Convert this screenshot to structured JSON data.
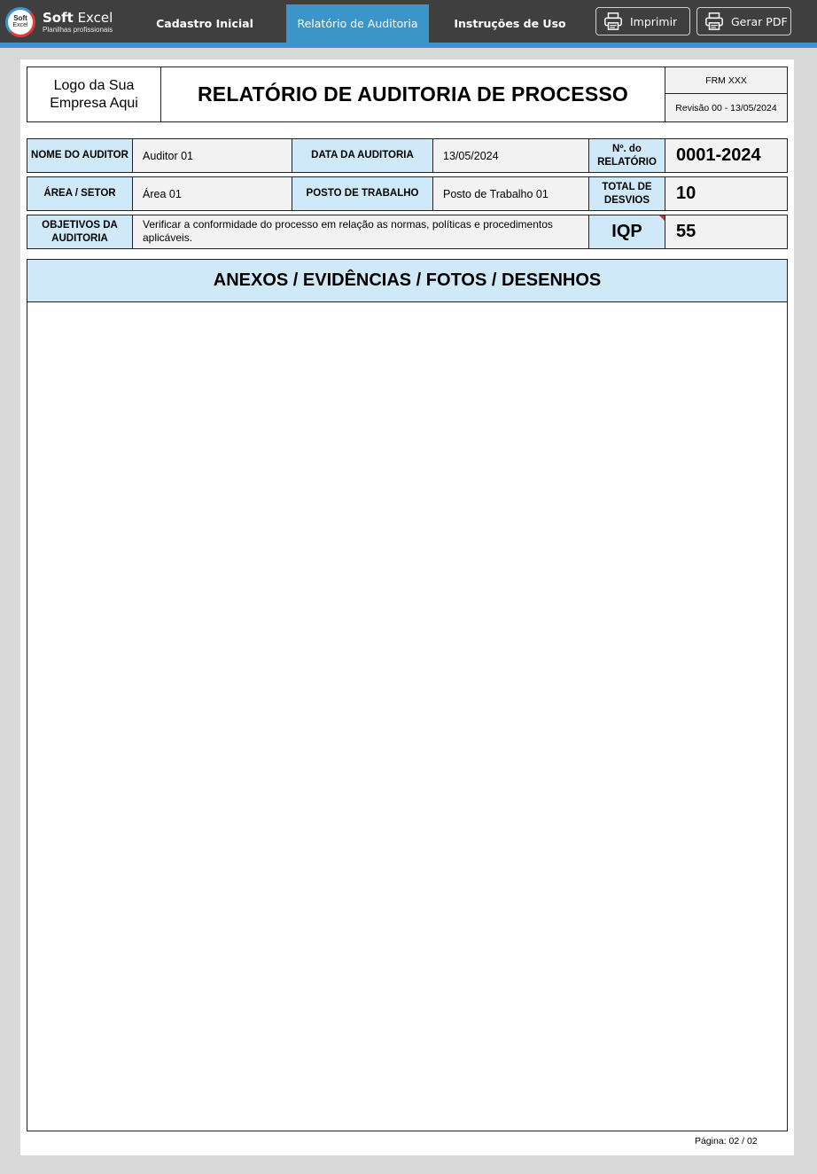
{
  "app": {
    "brand_name_bold": "Soft",
    "brand_name_rest": " Excel",
    "brand_tagline": "Planilhas profissionais",
    "logo_line1": "Soft",
    "logo_line2": "Excel"
  },
  "nav": {
    "tabs": [
      {
        "label": "Cadastro Inicial",
        "active": false
      },
      {
        "label": "Relatório de Auditoria",
        "active": true
      },
      {
        "label": "Instruções de Uso",
        "active": false
      }
    ]
  },
  "toolbar": {
    "print_label": "Imprimir",
    "pdf_label": "Gerar PDF",
    "print_icon": "printer-icon",
    "pdf_icon": "printer-icon"
  },
  "colors": {
    "topbar": "#3f3f3f",
    "accent": "#3b95c9",
    "label_fill": "#cfe9f9",
    "value_fill": "#f2f2f2"
  },
  "report": {
    "logo_placeholder": "Logo da Sua Empresa Aqui",
    "title": "RELATÓRIO DE AUDITORIA DE PROCESSO",
    "form_code": "FRM XXX",
    "revision": "Revisão 00 - 13/05/2024",
    "fields": {
      "auditor_label": "NOME DO AUDITOR",
      "auditor_value": "Auditor 01",
      "date_label": "DATA DA AUDITORIA",
      "date_value": "13/05/2024",
      "report_no_label": "Nº. do RELATÓRIO",
      "report_no_value": "0001-2024",
      "area_label": "ÁREA / SETOR",
      "area_value": "Área 01",
      "post_label": "POSTO DE TRABALHO",
      "post_value": "Posto de Trabalho 01",
      "deviations_label": "TOTAL DE DESVIOS",
      "deviations_value": "10",
      "objectives_label": "OBJETIVOS DA AUDITORIA",
      "objectives_value": "Verificar a conformidade do processo em relação as normas, políticas e procedimentos aplicáveis.",
      "iqp_label": "IQP",
      "iqp_value": "55"
    },
    "attachments_title": "ANEXOS / EVIDÊNCIAS /  FOTOS / DESENHOS",
    "page_label": "Página: 02 / 02"
  }
}
